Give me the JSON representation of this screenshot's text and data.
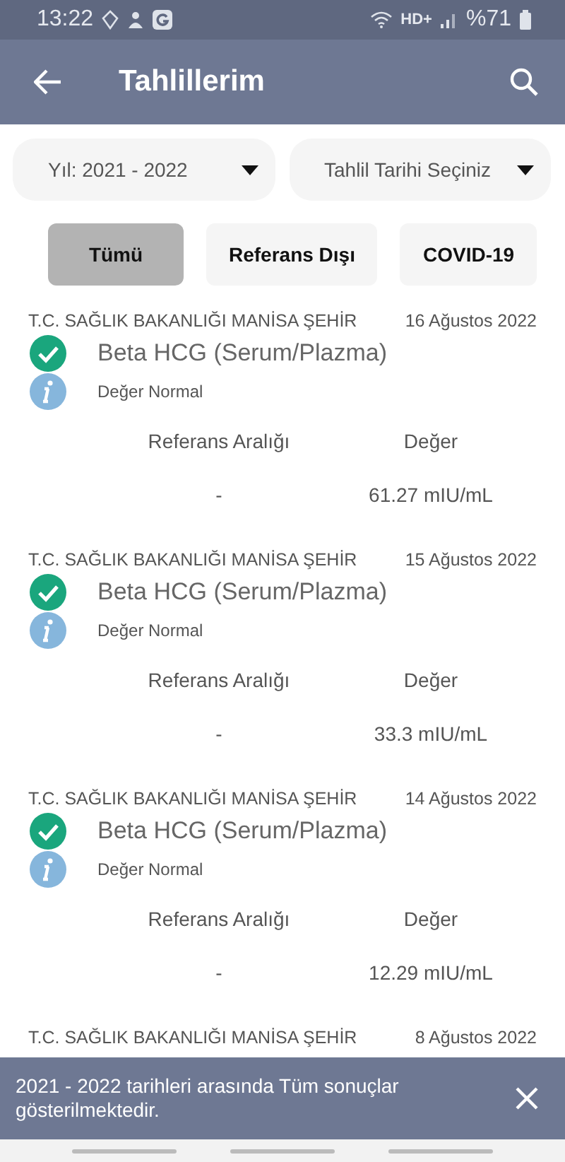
{
  "status_bar": {
    "time": "13:22",
    "network": "HD+",
    "battery": "%71"
  },
  "app_bar": {
    "title": "Tahlillerim"
  },
  "filters": [
    {
      "label": "Yıl: 2021 - 2022"
    },
    {
      "label": "Tahlil Tarihi Seçiniz"
    }
  ],
  "chips": [
    {
      "label": "Tümü",
      "selected": true
    },
    {
      "label": "Referans Dışı",
      "selected": false
    },
    {
      "label": "COVID-19",
      "selected": false
    }
  ],
  "results": [
    {
      "institution": "T.C. SAĞLIK BAKANLIĞI MANİSA ŞEHİR",
      "date": "16 Ağustos 2022",
      "test": "Beta HCG (Serum/Plazma)",
      "checked": true,
      "note": "Değer Normal",
      "range_label": "Referans Aralığı",
      "value_label": "Değer",
      "range": "-",
      "value": "61.27 mIU/mL"
    },
    {
      "institution": "T.C. SAĞLIK BAKANLIĞI MANİSA ŞEHİR",
      "date": "15 Ağustos 2022",
      "test": "Beta HCG (Serum/Plazma)",
      "checked": true,
      "note": "Değer Normal",
      "range_label": "Referans Aralığı",
      "value_label": "Değer",
      "range": "-",
      "value": "33.3 mIU/mL"
    },
    {
      "institution": "T.C. SAĞLIK BAKANLIĞI MANİSA ŞEHİR",
      "date": "14 Ağustos 2022",
      "test": "Beta HCG (Serum/Plazma)",
      "checked": true,
      "note": "Değer Normal",
      "range_label": "Referans Aralığı",
      "value_label": "Değer",
      "range": "-",
      "value": "12.29 mIU/mL"
    },
    {
      "institution": "T.C. SAĞLIK BAKANLIĞI MANİSA ŞEHİR",
      "date": "8 Ağustos 2022"
    }
  ],
  "snackbar": {
    "message": "2021 - 2022 tarihleri arasında Tüm sonuçlar gösterilmektedir."
  }
}
